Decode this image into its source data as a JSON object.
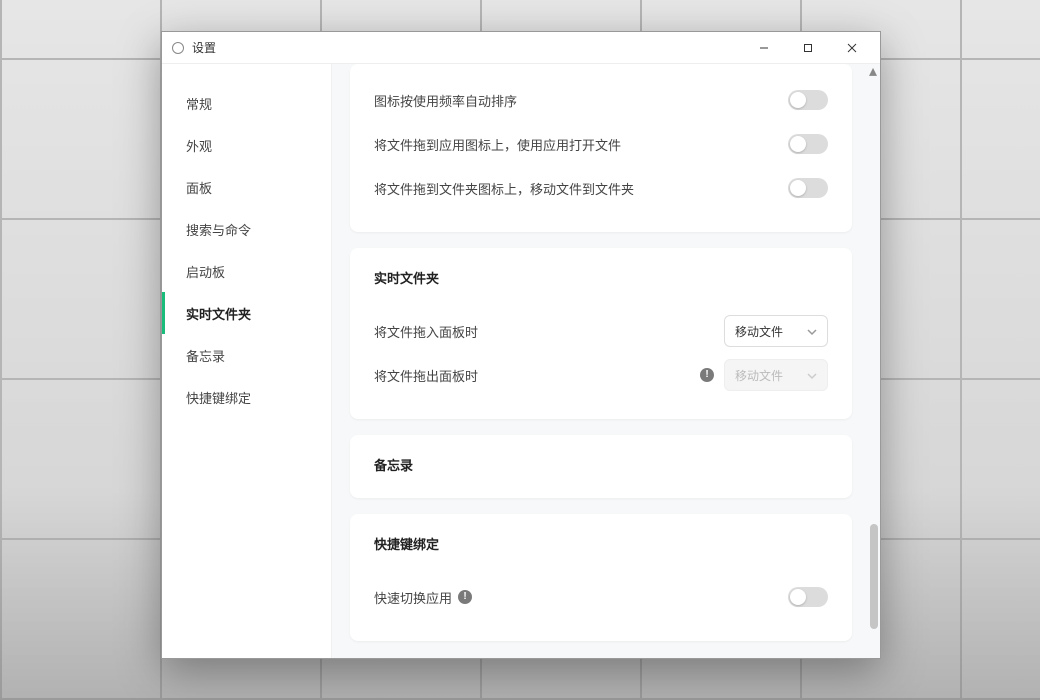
{
  "window": {
    "title": "设置"
  },
  "sidebar": {
    "items": [
      {
        "label": "常规"
      },
      {
        "label": "外观"
      },
      {
        "label": "面板"
      },
      {
        "label": "搜索与命令"
      },
      {
        "label": "启动板"
      },
      {
        "label": "实时文件夹"
      },
      {
        "label": "备忘录"
      },
      {
        "label": "快捷键绑定"
      }
    ],
    "active_index": 5
  },
  "section_top": {
    "rows": [
      {
        "label": "图标按使用频率自动排序",
        "toggle": false
      },
      {
        "label": "将文件拖到应用图标上，使用应用打开文件",
        "toggle": false
      },
      {
        "label": "将文件拖到文件夹图标上，移动文件到文件夹",
        "toggle": false
      }
    ]
  },
  "section_live_folder": {
    "title": "实时文件夹",
    "row_in": {
      "label": "将文件拖入面板时",
      "select_value": "移动文件",
      "disabled": false
    },
    "row_out": {
      "label": "将文件拖出面板时",
      "select_value": "移动文件",
      "disabled": true
    }
  },
  "section_memo": {
    "title": "备忘录"
  },
  "section_hotkey": {
    "title": "快捷键绑定",
    "row1": {
      "label": "快速切换应用",
      "toggle": false
    }
  }
}
